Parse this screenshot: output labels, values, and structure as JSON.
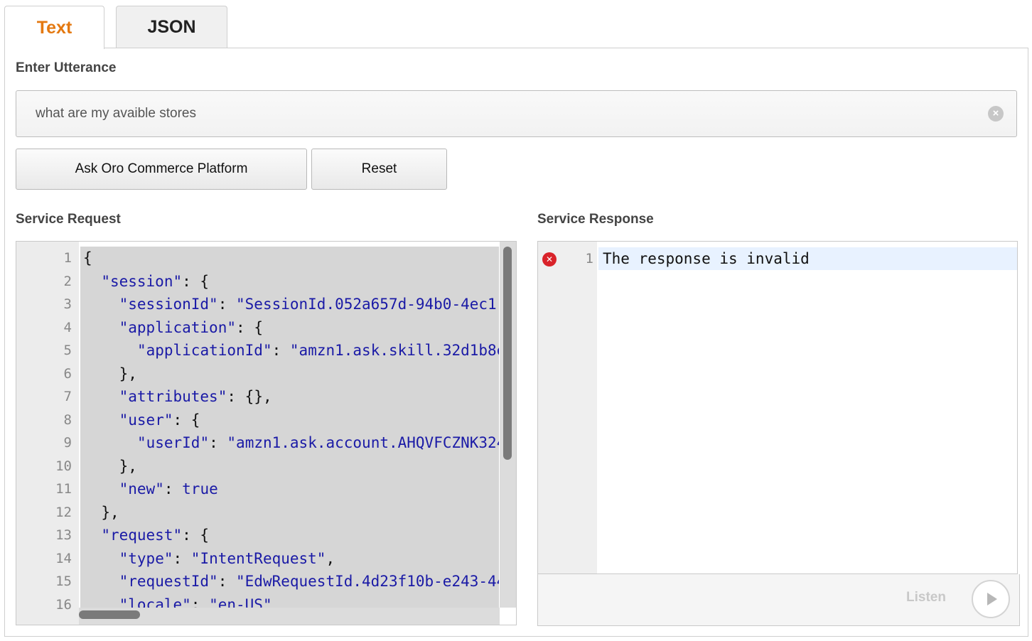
{
  "tabs": [
    {
      "label": "Text",
      "active": true
    },
    {
      "label": "JSON",
      "active": false
    }
  ],
  "utterance": {
    "label": "Enter Utterance",
    "value": "what are my avaible stores"
  },
  "buttons": {
    "ask": "Ask Oro Commerce Platform",
    "reset": "Reset"
  },
  "request": {
    "label": "Service Request",
    "line_numbers": [
      "1",
      "2",
      "3",
      "4",
      "5",
      "6",
      "7",
      "8",
      "9",
      "10",
      "11",
      "12",
      "13",
      "14",
      "15",
      "16"
    ],
    "lines": [
      "{",
      "  \"session\": {",
      "    \"sessionId\": \"SessionId.052a657d-94b0-4ec1-",
      "    \"application\": {",
      "      \"applicationId\": \"amzn1.ask.skill.32d1b8e",
      "    },",
      "    \"attributes\": {},",
      "    \"user\": {",
      "      \"userId\": \"amzn1.ask.account.AHQVFCZNK324",
      "    },",
      "    \"new\": true",
      "  },",
      "  \"request\": {",
      "    \"type\": \"IntentRequest\",",
      "    \"requestId\": \"EdwRequestId.4d23f10b-e243-44",
      "    \"locale\": \"en-US\""
    ]
  },
  "response": {
    "label": "Service Response",
    "line_number": "1",
    "text": "The response is invalid",
    "error_icon": "error-x-icon"
  },
  "listen": {
    "label": "Listen",
    "icon": "play-icon"
  },
  "colors": {
    "accent": "#e47911",
    "error": "#d9232a",
    "code_key": "#1a1aa6"
  }
}
